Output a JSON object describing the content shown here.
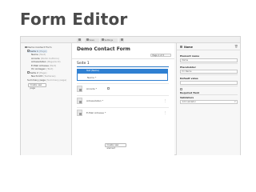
{
  "slide": {
    "title": "Form Editor"
  },
  "toolbar": {
    "back_label": "",
    "save_label": "Save",
    "settings_label": "Settings",
    "close_label": ""
  },
  "tree": {
    "items": [
      {
        "label": "Demo Contact Form",
        "note": ""
      },
      {
        "label": "Seite 1",
        "note": "(Page)"
      },
      {
        "label": "Name",
        "note": "(Text)"
      },
      {
        "label": "Anrede",
        "note": "(Radio buttons)"
      },
      {
        "label": "Adressdaten",
        "note": "(Page/Grid)"
      },
      {
        "label": "E-Mail Adresse",
        "note": "(Text)"
      },
      {
        "label": "Ihr Anliegen",
        "note": "(Text)"
      },
      {
        "label": "Seite 2",
        "note": "(Page)"
      },
      {
        "label": "Nachricht",
        "note": "(Textarea)"
      },
      {
        "label": "Summary page",
        "note": "(Summary page)"
      }
    ],
    "create_page_label": "Create new page"
  },
  "center": {
    "form_title": "Demo Contact Form",
    "pager_label": "Page 1 of 3",
    "page_title": "Seite 1",
    "selected_head": "Text (Name)",
    "elements": [
      {
        "label": "Name *"
      },
      {
        "label": "Anrede *"
      },
      {
        "label": "Adressdaten *"
      },
      {
        "label": "E-Mail Adresse *"
      }
    ],
    "create_element_label": "Create new element"
  },
  "inspector": {
    "title": "Name",
    "element_name_label": "Element name",
    "element_name_value": "Name",
    "placeholder_label": "Placeholder",
    "placeholder_value": "Ihr Name",
    "default_value_label": "Default value",
    "default_value_value": "",
    "required_label": "Required field",
    "validators_label": "Validators",
    "validators_value": "Add validator"
  }
}
